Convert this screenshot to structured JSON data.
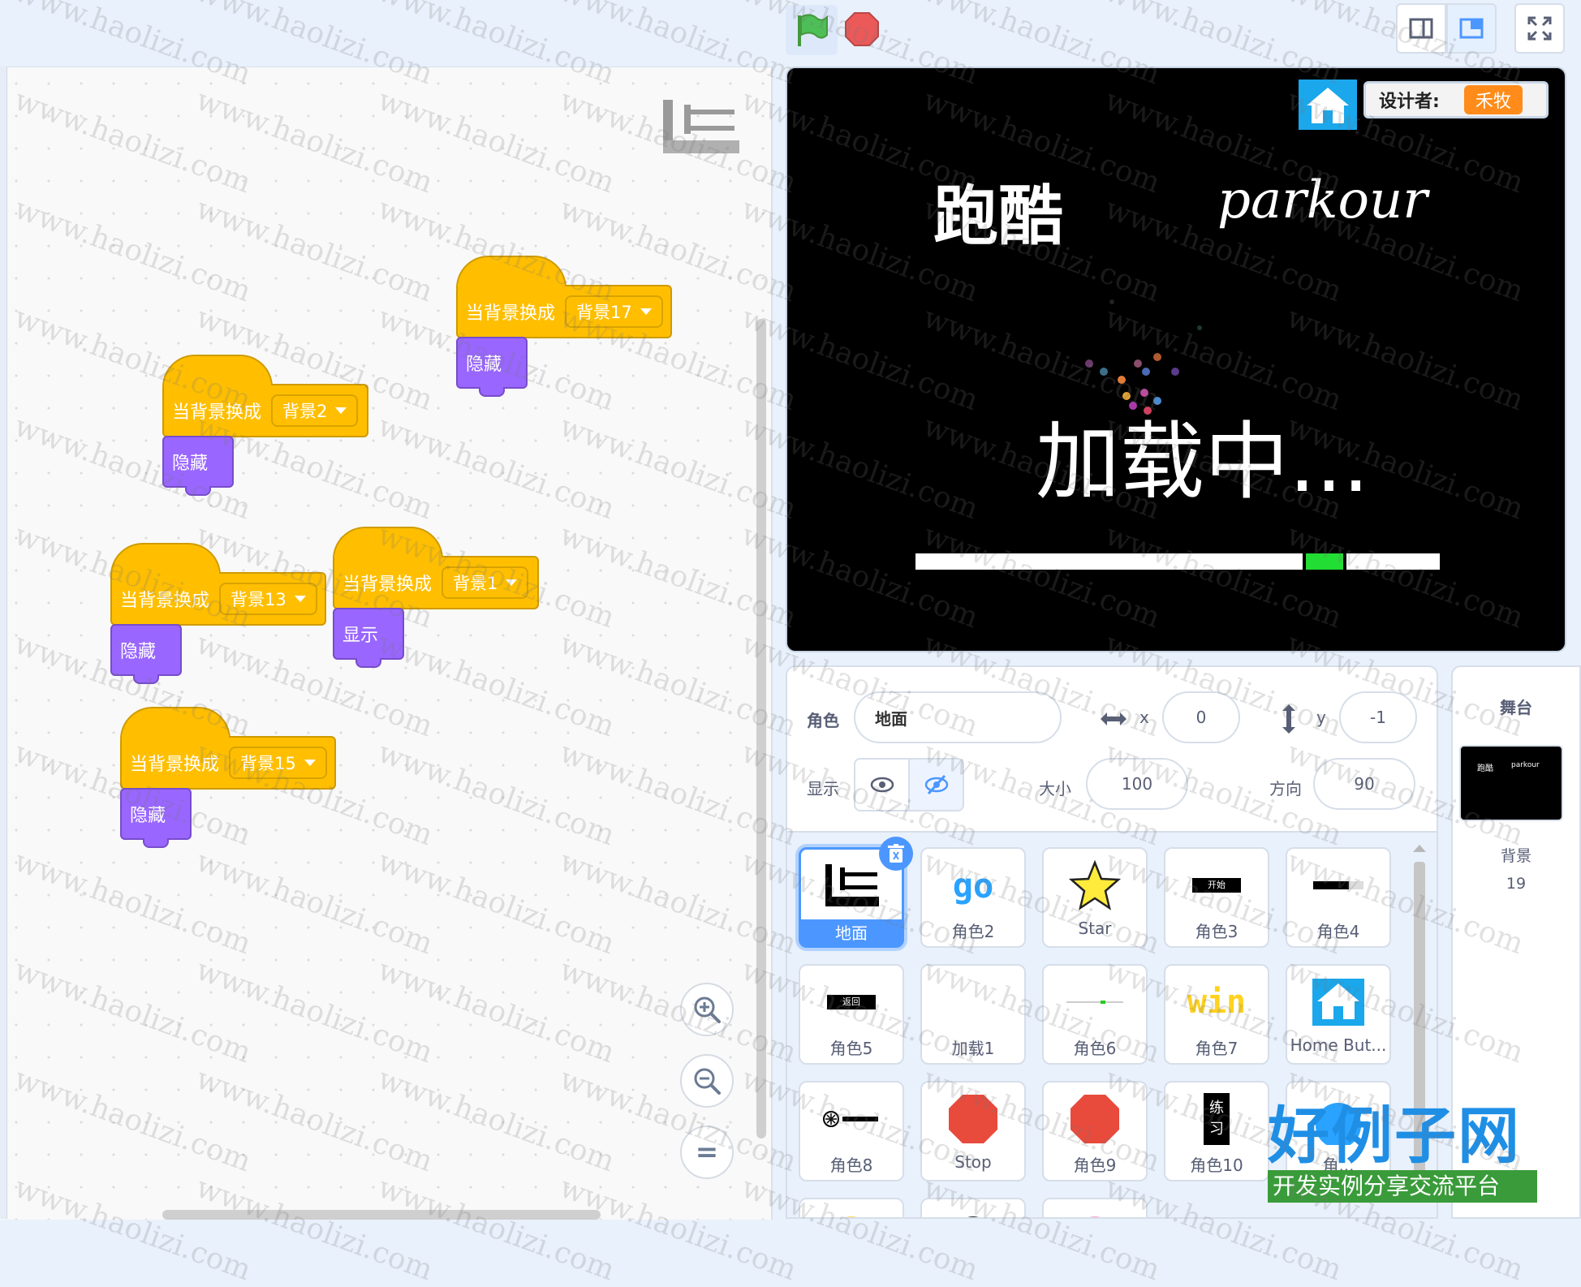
{
  "code": {
    "blocks": [
      {
        "hat_label": "当背景换成",
        "backdrop": "背景17",
        "stack_label": "隐藏"
      },
      {
        "hat_label": "当背景换成",
        "backdrop": "背景2",
        "stack_label": "隐藏"
      },
      {
        "hat_label": "当背景换成",
        "backdrop": "背景13",
        "stack_label": "隐藏"
      },
      {
        "hat_label": "当背景换成",
        "backdrop": "背景1",
        "stack_label": "显示"
      },
      {
        "hat_label": "当背景换成",
        "backdrop": "背景15",
        "stack_label": "隐藏"
      }
    ],
    "zoom_in": "⊕",
    "zoom_out": "⊖",
    "zoom_reset": "="
  },
  "stage": {
    "title_cn": "跑酷",
    "title_en": "parkour",
    "loading": "加载中...",
    "designer_label": "设计者:",
    "designer_name": "禾牧",
    "progress": 0.78
  },
  "sprite_info": {
    "sprite_label": "角色",
    "sprite_name": "地面",
    "x_label": "x",
    "x_value": "0",
    "y_label": "y",
    "y_value": "-1",
    "show_label": "显示",
    "size_label": "大小",
    "size_value": "100",
    "direction_label": "方向",
    "direction_value": "90"
  },
  "sprites": [
    {
      "name": "地面",
      "icon": "ground-icon",
      "selected": true
    },
    {
      "name": "角色2",
      "icon": "go-text"
    },
    {
      "name": "Star",
      "icon": "star-icon"
    },
    {
      "name": "角色3",
      "icon": "start-button-thumb",
      "thumb_text": "开始"
    },
    {
      "name": "角色4",
      "icon": "bar-thumb"
    },
    {
      "name": "角色5",
      "icon": "back-button-thumb",
      "thumb_text": "返回"
    },
    {
      "name": "加载1",
      "icon": "loading-thumb"
    },
    {
      "name": "角色6",
      "icon": "line-thumb"
    },
    {
      "name": "角色7",
      "icon": "win-text"
    },
    {
      "name": "Home But...",
      "icon": "home-icon"
    },
    {
      "name": "角色8",
      "icon": "logo-thumb"
    },
    {
      "name": "Stop",
      "icon": "stop-octagon"
    },
    {
      "name": "角色9",
      "icon": "stop-octagon"
    },
    {
      "name": "角色10",
      "icon": "practice-thumb",
      "thumb_text": "练\n习"
    },
    {
      "name": "角...",
      "icon": "blue-circle"
    }
  ],
  "stage_panel": {
    "title": "舞台",
    "backdrop_label": "背景",
    "backdrop_count": "19"
  },
  "watermark": {
    "text": "www.haolizi.com",
    "brand": "好例子网",
    "tagline": "开发实例分享交流平台"
  },
  "colors": {
    "events": "#ffbf00",
    "looks": "#9966ff",
    "accent": "#4c97ff",
    "green_flag": "#4cbf56",
    "stop": "#ec5959"
  }
}
